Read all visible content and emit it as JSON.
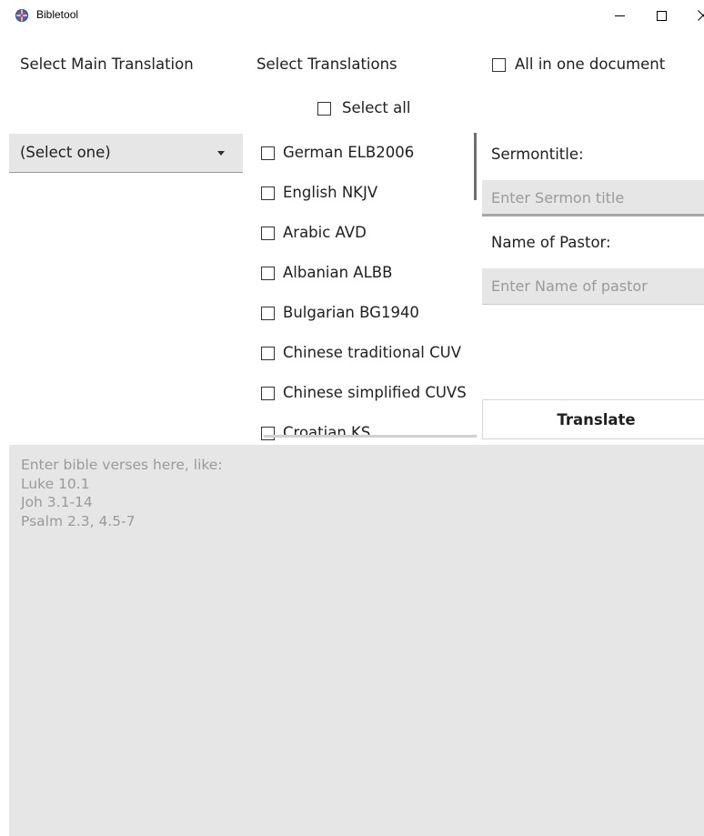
{
  "window": {
    "title": "Bibletool",
    "icon": "bible-globe-icon",
    "controls": {
      "minimize": "minimize-icon",
      "maximize": "maximize-icon",
      "close": "close-icon"
    }
  },
  "main_translation": {
    "label": "Select Main Translation",
    "dropdown_value": "(Select one)"
  },
  "translations": {
    "label": "Select Translations",
    "select_all": "Select all",
    "items": [
      {
        "label": "German ELB2006",
        "checked": false
      },
      {
        "label": "English NKJV",
        "checked": false
      },
      {
        "label": "Arabic AVD",
        "checked": false
      },
      {
        "label": "Albanian ALBB",
        "checked": false
      },
      {
        "label": "Bulgarian BG1940",
        "checked": false
      },
      {
        "label": "Chinese traditional CUV",
        "checked": false
      },
      {
        "label": "Chinese simplified CUVS",
        "checked": false
      },
      {
        "label": "Croatian KS",
        "checked": false
      }
    ]
  },
  "options": {
    "all_in_one_document": "All in one document",
    "sermon_title_label": "Sermontitle:",
    "sermon_title_placeholder": "Enter Sermon title",
    "pastor_label": "Name of Pastor:",
    "pastor_placeholder": "Enter Name of pastor",
    "translate_button": "Translate"
  },
  "verses": {
    "placeholder": "Enter bible verses here, like:\nLuke 10.1\nJoh 3.1-14\nPsalm 2.3, 4.5-7"
  },
  "colors": {
    "field_bg": "#e6e6e6",
    "placeholder_text": "#9a9a9a",
    "text": "#202020"
  }
}
